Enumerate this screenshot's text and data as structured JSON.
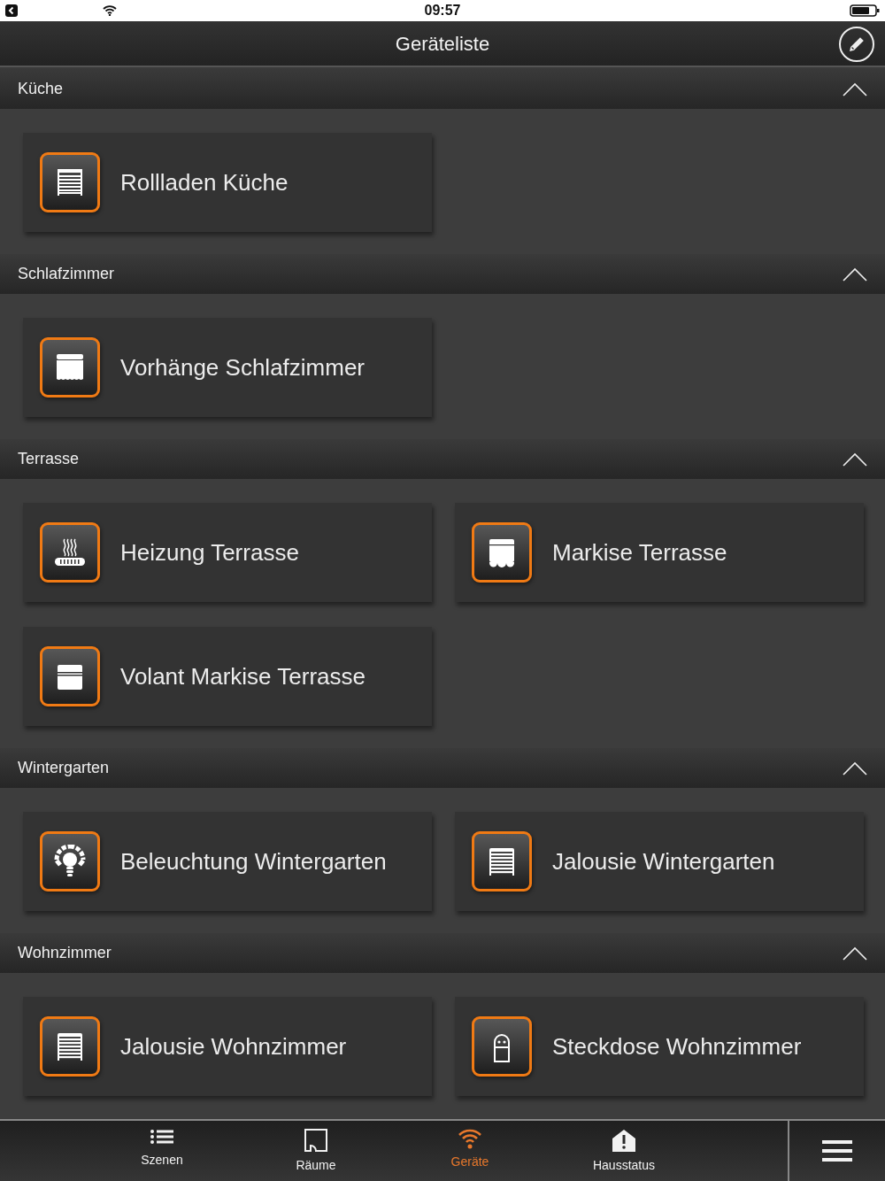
{
  "status_bar": {
    "time": "09:57"
  },
  "header": {
    "title": "Geräteliste"
  },
  "sections": [
    {
      "title": "Küche",
      "expanded": true,
      "devices": [
        {
          "name": "Rollladen Küche",
          "kind": "roller"
        }
      ]
    },
    {
      "title": "Schlafzimmer",
      "expanded": true,
      "devices": [
        {
          "name": "Vorhänge Schlafzimmer",
          "kind": "curtain"
        }
      ]
    },
    {
      "title": "Terrasse",
      "expanded": true,
      "devices": [
        {
          "name": "Heizung Terrasse",
          "kind": "heater"
        },
        {
          "name": "Markise Terrasse",
          "kind": "awning"
        },
        {
          "name": "Volant Markise Terrasse",
          "kind": "valance"
        }
      ]
    },
    {
      "title": "Wintergarten",
      "expanded": true,
      "devices": [
        {
          "name": "Beleuchtung Wintergarten",
          "kind": "light"
        },
        {
          "name": "Jalousie Wintergarten",
          "kind": "blind"
        }
      ]
    },
    {
      "title": "Wohnzimmer",
      "expanded": true,
      "devices": [
        {
          "name": "Jalousie Wohnzimmer",
          "kind": "blind"
        },
        {
          "name": "Steckdose Wohnzimmer",
          "kind": "socket"
        }
      ]
    }
  ],
  "tab_bar": [
    {
      "label": "Szenen",
      "kind": "list",
      "selected": false
    },
    {
      "label": "Räume",
      "kind": "room",
      "selected": false
    },
    {
      "label": "Geräte",
      "kind": "wifi",
      "selected": true
    },
    {
      "label": "Hausstatus",
      "kind": "house",
      "selected": false
    }
  ]
}
